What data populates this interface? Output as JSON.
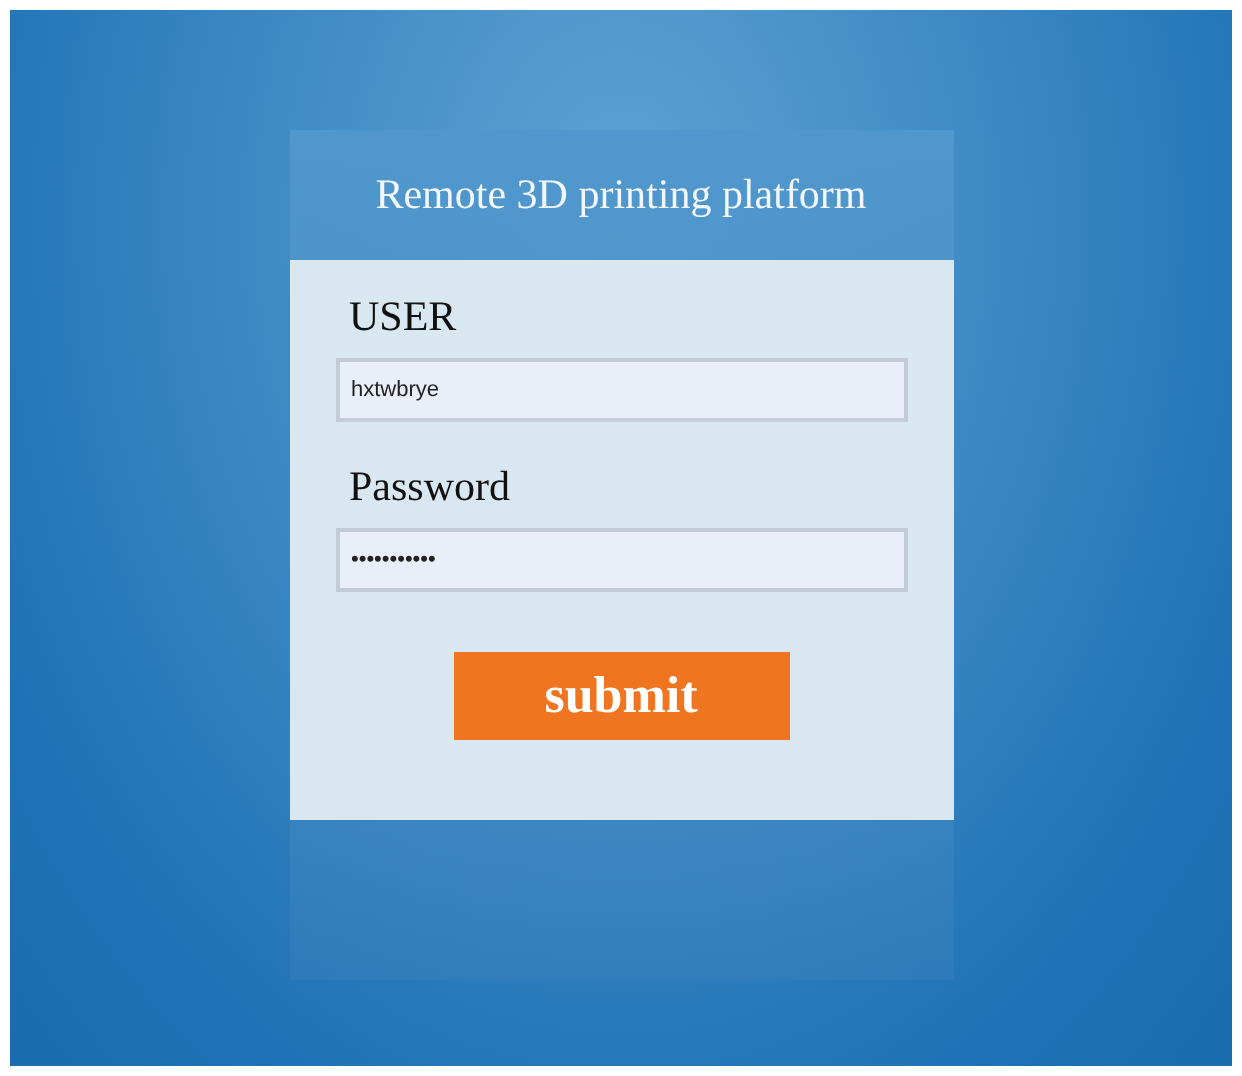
{
  "title": "Remote 3D printing platform",
  "fields": [
    {
      "label": "USER",
      "value": "hxtwbrye"
    },
    {
      "label": "Password",
      "value": "•••••••••••"
    }
  ],
  "submit": "submit"
}
